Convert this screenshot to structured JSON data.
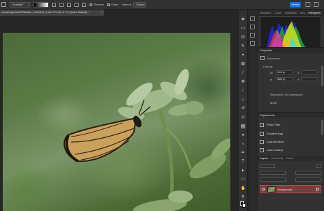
{
  "options_bar": {
    "tool_preset": "Gradient",
    "reverse_label": "Reverse",
    "dither_label": "Dither",
    "method_label": "Method:",
    "method_value": "Classic",
    "share_label": "Share"
  },
  "document": {
    "tab_title": "ovolanAgencies\\NPBtatan_20230129_0112.JPG @ 16.7% (Quick Mask/8) *",
    "close_glyph": "×"
  },
  "panels": {
    "histogram_tabs": [
      "Navigator",
      "Color",
      "Swatches",
      "Info",
      "Histogram"
    ],
    "histogram_active": "Histogram",
    "properties": {
      "title": "Properties",
      "subtitle": "Document",
      "canvas_label": "Canvas",
      "width_label": "W",
      "width_value": "5184 px",
      "height_label": "H",
      "height_value": "3888 px",
      "x_label": "X",
      "y_label": "Y",
      "resolution": "Resolution: 300 pixels/inch",
      "mode": "Mode"
    },
    "adjustments": {
      "title": "Adjustments",
      "items": [
        "Photo Filter",
        "Gradient Map",
        "Channel Mixer",
        "Color Lookup"
      ]
    },
    "layers": {
      "tabs": [
        "Layers",
        "Channels",
        "Paths"
      ],
      "active_tab": "Layers",
      "layer_name": "Background"
    }
  },
  "colors": {
    "accent": "#1473e6",
    "layer_selected": "#7a3c3c"
  }
}
